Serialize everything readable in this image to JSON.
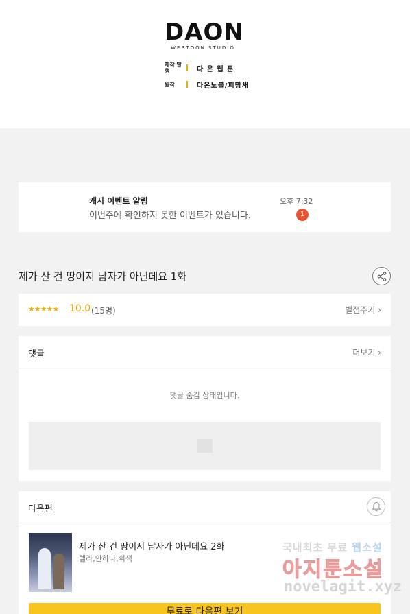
{
  "header": {
    "logo": "DAON",
    "logo_sub": "WEBTOON STUDIO",
    "credits": [
      {
        "label": "제작 발행",
        "value": "다 온 웹 툰"
      },
      {
        "label": "원작",
        "value": "다온노블/피망새"
      }
    ]
  },
  "notification": {
    "title": "캐시 이벤트 알림",
    "message": "이번주에 확인하지 못한 이벤트가 있습니다.",
    "time": "오후 7:32",
    "badge": "1",
    "badge_color": "#e8532e"
  },
  "episode": {
    "title": "제가 산 건 땅이지 남자가 아닌데요 1화",
    "share_icon": "share-icon"
  },
  "rating": {
    "stars": "★★★★★",
    "score": "10.0",
    "count": "(15명)",
    "rate_label": "별점주기",
    "star_color": "#f2a900"
  },
  "comments": {
    "title": "댓글",
    "more_label": "더보기",
    "hidden_message": "댓글 숨김 상태입니다."
  },
  "next_episode": {
    "section_title": "다음편",
    "title": "제가 산 건 땅이지 남자가 아닌데요 2화",
    "authors": "텔라,안하나,휘색",
    "button_label": "무료로 다음편 보기",
    "button_color": "#f7c51e"
  },
  "watermark": {
    "line1_a": "국내최초 무료",
    "line1_b": "웹소설",
    "line2": "아지툰소설",
    "line3": "novelagit.xyz"
  }
}
